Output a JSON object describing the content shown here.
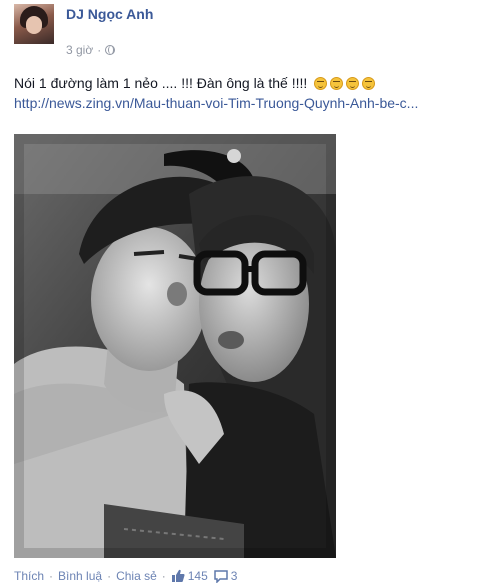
{
  "post": {
    "author_name": "DJ Ngọc Anh",
    "time": "3 giờ",
    "privacy_separator": "·",
    "privacy_icon": "globe-icon",
    "message": "Nói 1 đường làm 1 nẻo .... !!! Đàn ông là thế !!!!",
    "emoji_icon": "smirk-face-emoji",
    "emoji_count": 4,
    "link": "http://news.zing.vn/Mau-thuan-voi-Tim-Truong-Quynh-Anh-be-c...",
    "photo_description_icon": "couple-selfie-photo"
  },
  "actions": {
    "like_label": "Thích",
    "comment_label": "Bình luậ",
    "share_label": "Chia sẻ",
    "separator": "·",
    "like_count": "145",
    "comment_count": "3"
  },
  "colors": {
    "link_blue": "#3b5998",
    "action_blue": "#6d84b4",
    "meta_gray": "#9197a3",
    "text": "#141823"
  }
}
